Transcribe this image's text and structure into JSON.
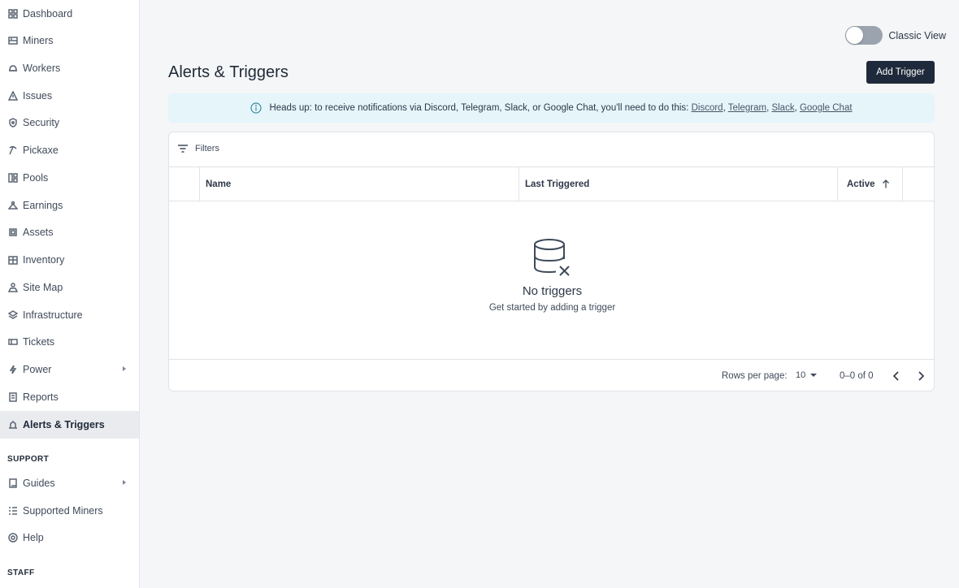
{
  "sidebar": {
    "items": [
      {
        "label": "Dashboard",
        "icon": "dashboard-icon"
      },
      {
        "label": "Miners",
        "icon": "miners-icon"
      },
      {
        "label": "Workers",
        "icon": "workers-icon"
      },
      {
        "label": "Issues",
        "icon": "warning-icon"
      },
      {
        "label": "Security",
        "icon": "shield-icon"
      },
      {
        "label": "Pickaxe",
        "icon": "pickaxe-icon"
      },
      {
        "label": "Pools",
        "icon": "pools-icon"
      },
      {
        "label": "Earnings",
        "icon": "earnings-icon"
      },
      {
        "label": "Assets",
        "icon": "assets-icon"
      },
      {
        "label": "Inventory",
        "icon": "inventory-icon"
      },
      {
        "label": "Site Map",
        "icon": "site-map-icon"
      },
      {
        "label": "Infrastructure",
        "icon": "layers-icon"
      },
      {
        "label": "Tickets",
        "icon": "ticket-icon"
      },
      {
        "label": "Power",
        "icon": "lightning-icon"
      },
      {
        "label": "Reports",
        "icon": "report-icon"
      },
      {
        "label": "Alerts & Triggers",
        "icon": "alarm-icon"
      }
    ],
    "support_heading": "SUPPORT",
    "support_items": [
      {
        "label": "Guides",
        "icon": "book-icon"
      },
      {
        "label": "Supported Miners",
        "icon": "checklist-icon"
      },
      {
        "label": "Help",
        "icon": "help-icon"
      }
    ],
    "staff_heading": "STAFF"
  },
  "header": {
    "toggle_label": "Classic View",
    "title": "Alerts & Triggers",
    "add_button": "Add Trigger"
  },
  "alert": {
    "text": "Heads up: to receive notifications via Discord, Telegram, Slack, or Google Chat, you'll need to do this: ",
    "links": [
      "Discord",
      "Telegram",
      "Slack",
      "Google Chat"
    ],
    "separator": ", "
  },
  "table": {
    "filters_label": "Filters",
    "columns": [
      "Name",
      "Last Triggered",
      "Active"
    ],
    "sorted_column": "Active",
    "empty_title": "No triggers",
    "empty_subtitle": "Get started by adding a trigger"
  },
  "pagination": {
    "rows_label": "Rows per page:",
    "rows_value": "10",
    "range": "0–0 of 0"
  }
}
